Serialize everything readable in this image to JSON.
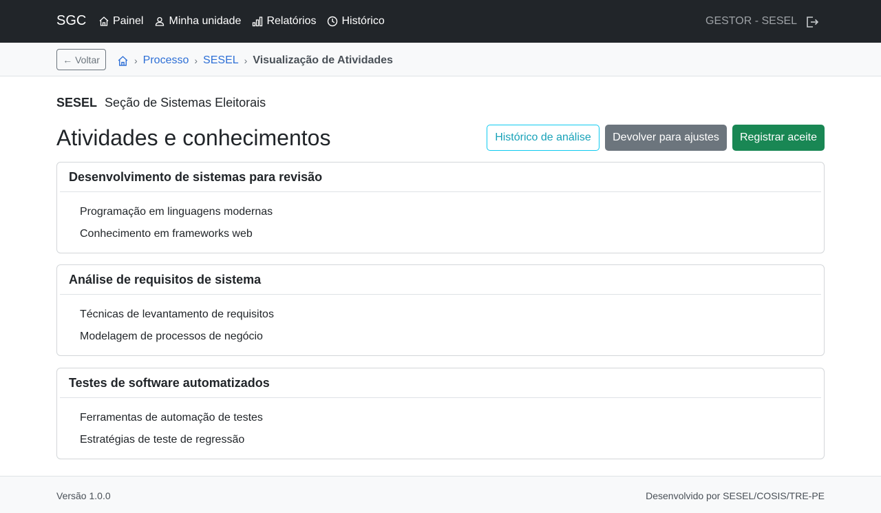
{
  "navbar": {
    "brand": "SGC",
    "links": [
      {
        "label": "Painel",
        "icon": "house-icon"
      },
      {
        "label": "Minha unidade",
        "icon": "person-icon"
      },
      {
        "label": "Relatórios",
        "icon": "bar-chart-icon"
      },
      {
        "label": "Histórico",
        "icon": "clock-icon"
      }
    ],
    "user": "GESTOR - SESEL",
    "logout_icon": "logout-icon"
  },
  "breadcrumb": {
    "back_label": "Voltar",
    "items": [
      "Processo",
      "SESEL"
    ],
    "current": "Visualização de Atividades"
  },
  "unit": {
    "sigla": "SESEL",
    "name": "Seção de Sistemas Eleitorais"
  },
  "page": {
    "title": "Atividades e conhecimentos"
  },
  "actions": {
    "history": "Histórico de análise",
    "return": "Devolver para ajustes",
    "accept": "Registrar aceite"
  },
  "activities": [
    {
      "title": "Desenvolvimento de sistemas para revisão",
      "items": [
        "Programação em linguagens modernas",
        "Conhecimento em frameworks web"
      ]
    },
    {
      "title": "Análise de requisitos de sistema",
      "items": [
        "Técnicas de levantamento de requisitos",
        "Modelagem de processos de negócio"
      ]
    },
    {
      "title": "Testes de software automatizados",
      "items": [
        "Ferramentas de automação de testes",
        "Estratégias de teste de regressão"
      ]
    }
  ],
  "footer": {
    "version": "Versão 1.0.0",
    "developed_by": "Desenvolvido por SESEL/COSIS/TRE-PE"
  },
  "colors": {
    "navbar_bg": "#212529",
    "link": "#2d6fd6",
    "info": "#0dcaf0",
    "secondary": "#6c757d",
    "success": "#198754"
  }
}
